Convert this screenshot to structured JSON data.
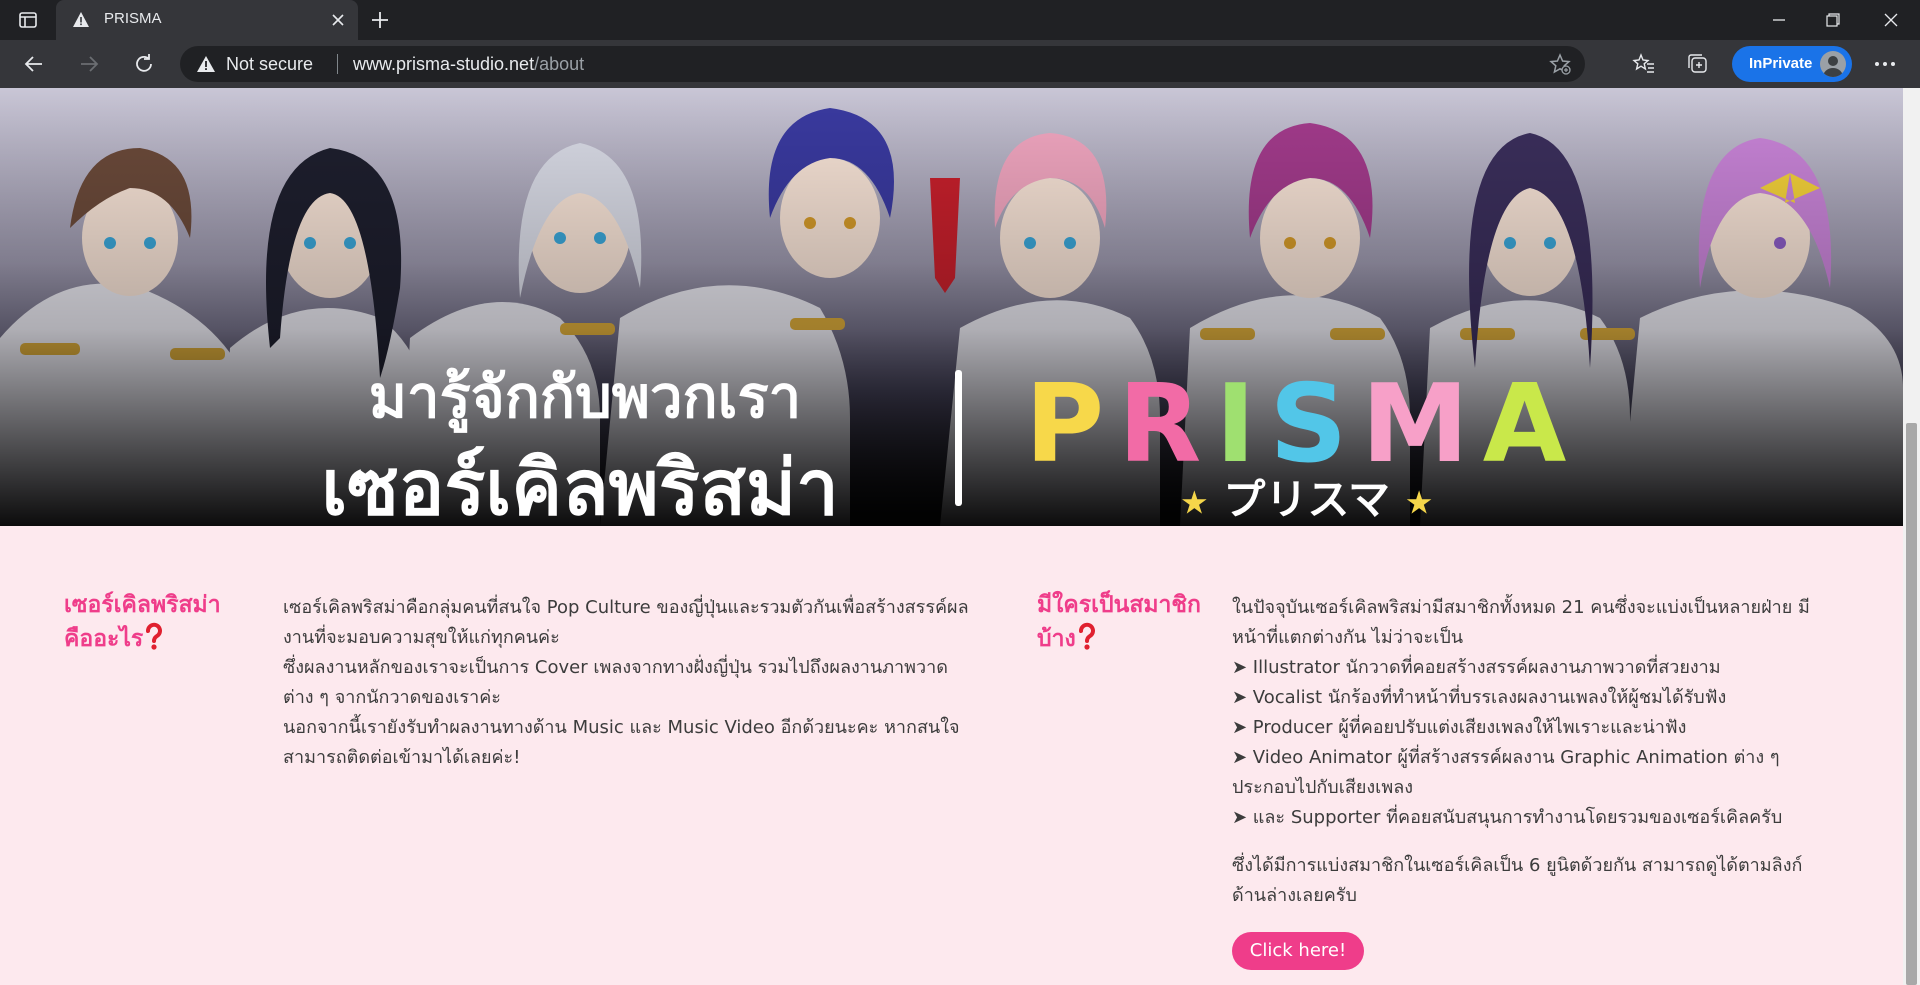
{
  "browser": {
    "tab_title": "PRISMA",
    "address": {
      "security_label": "Not secure",
      "host": "www.prisma-studio.net",
      "path": "/about"
    },
    "inprivate_label": "InPrivate"
  },
  "banner": {
    "tagline_small": "มารู้จักกับพวกเรา",
    "tagline_large": "เซอร์เคิลพริสม่า",
    "logo_letters": [
      {
        "char": "P",
        "color": "#f7d84a"
      },
      {
        "char": "R",
        "color": "#f26ba6"
      },
      {
        "char": "I",
        "color": "#9fe070"
      },
      {
        "char": "S",
        "color": "#52c6e8"
      },
      {
        "char": "M",
        "color": "#f7a0c8"
      },
      {
        "char": "A",
        "color": "#c9e84a"
      }
    ],
    "logo_kana": "プリスマ"
  },
  "about": {
    "heading_line1": "เซอร์เคิลพริสม่า",
    "heading_line2": "คืออะไร",
    "lines": [
      "เซอร์เคิลพริสม่าคือกลุ่มคนที่สนใจ Pop Culture ของญี่ปุ่นและรวมตัวกันเพื่อสร้างสรรค์ผล",
      "งานที่จะมอบความสุขให้แก่ทุกคนค่ะ",
      "ซึ่งผลงานหลักของเราจะเป็นการ Cover เพลงจากทางฝั่งญี่ปุ่น รวมไปถึงผลงานภาพวาด",
      "ต่าง ๆ จากนักวาดของเราค่ะ",
      "นอกจากนี้เรายังรับทำผลงานทางด้าน Music และ Music Video อีกด้วยนะคะ หากสนใจ",
      "สามารถติดต่อเข้ามาได้เลยค่ะ!"
    ]
  },
  "members": {
    "heading_line1": "มีใครเป็นสมาชิก",
    "heading_line2": "บ้าง",
    "lines": [
      "ในปัจจุบันเซอร์เคิลพริสม่ามีสมาชิกทั้งหมด 21 คนซึ่งจะแบ่งเป็นหลายฝ่าย มี",
      "หน้าที่แตกต่างกัน ไม่ว่าจะเป็น",
      "➤ Illustrator นักวาดที่คอยสร้างสรรค์ผลงานภาพวาดที่สวยงาม",
      "➤ Vocalist นักร้องที่ทำหน้าที่บรรเลงผลงานเพลงให้ผู้ชมได้รับฟัง",
      "➤ Producer ผู้ที่คอยปรับแต่งเสียงเพลงให้ไพเราะและน่าฟัง",
      "➤ Video Animator ผู้ที่สร้างสรรค์ผลงาน Graphic Animation ต่าง ๆ",
      "ประกอบไปกับเสียงเพลง",
      "➤ และ Supporter ที่คอยสนับสนุนการทำงานโดยรวมของเซอร์เคิลครับ"
    ],
    "footer_lines": [
      "ซึ่งได้มีการแบ่งสมาชิกในเซอร์เคิลเป็น 6 ยูนิตด้วยกัน สามารถดูได้ตามลิงก์",
      "ด้านล่างเลยครับ"
    ],
    "cta_label": "Click here!"
  },
  "colors": {
    "accent_pink": "#ef3d8a",
    "page_bg": "#fde9ee",
    "inprivate_blue": "#1a73e8"
  }
}
